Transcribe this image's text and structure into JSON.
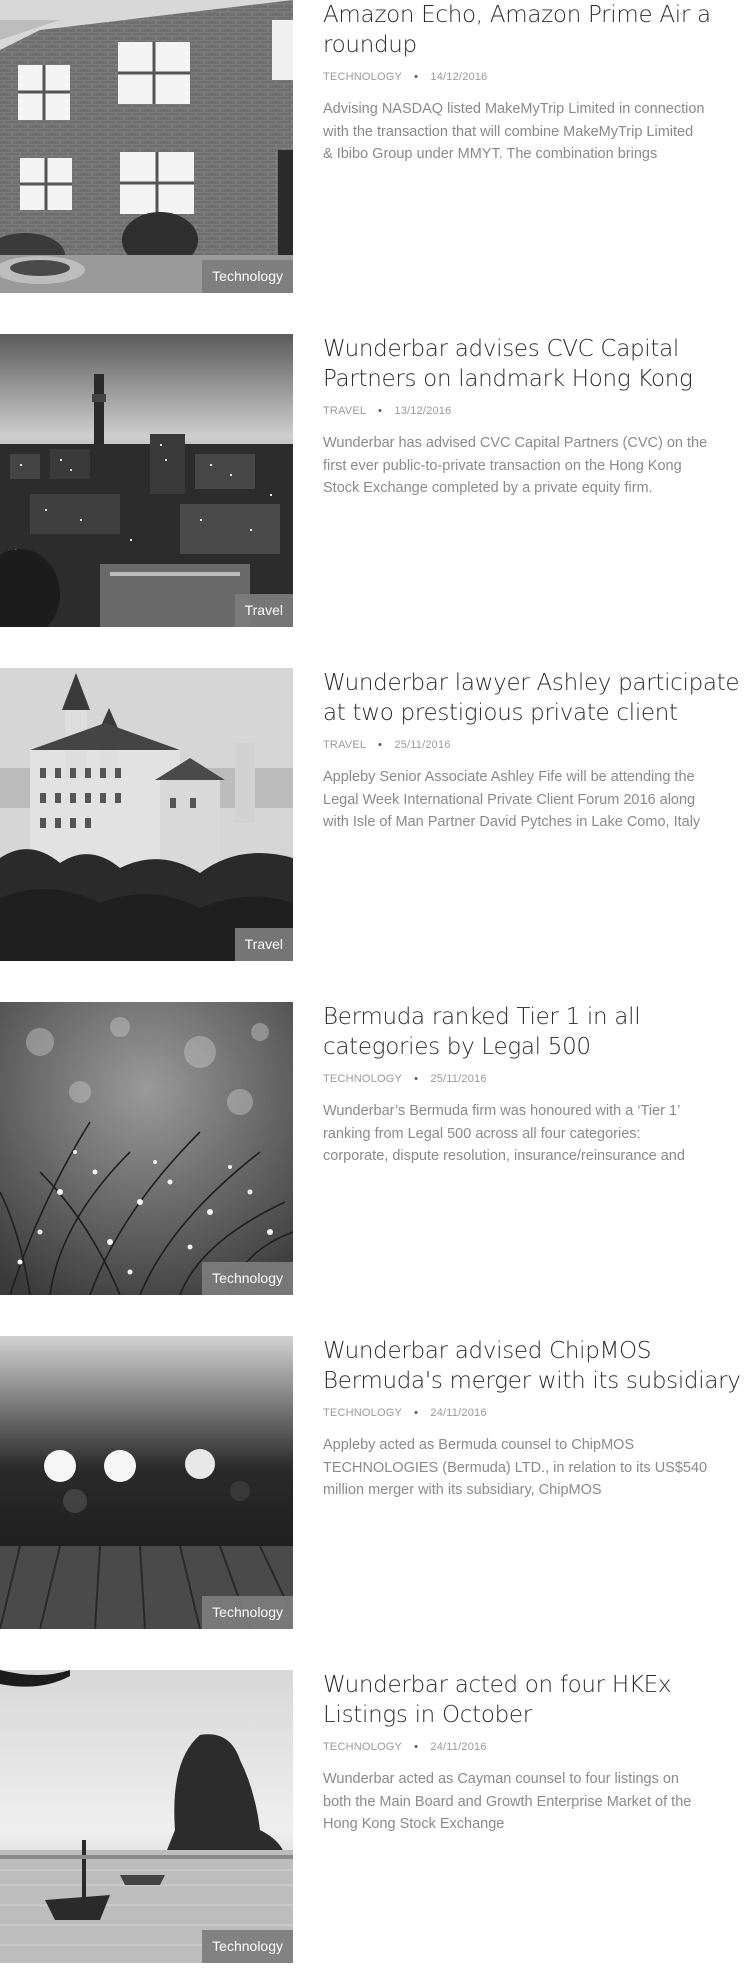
{
  "posts": [
    {
      "title_lines": [
        "Amazon Echo, Amazon Prime Air a",
        "roundup"
      ],
      "category": "TECHNOLOGY",
      "date": "14/12/2016",
      "excerpt_lines": [
        "Advising NASDAQ listed MakeMyTrip Limited in connection",
        "with the transaction that will combine MakeMyTrip Limited",
        "& Ibibo Group under MMYT. The combination brings"
      ],
      "badge": "Technology",
      "image": "brick-building-photo"
    },
    {
      "title_lines": [
        "Wunderbar advises CVC Capital",
        "Partners on landmark Hong Kong"
      ],
      "category": "TRAVEL",
      "date": "13/12/2016",
      "excerpt_lines": [
        "Wunderbar has advised CVC Capital Partners (CVC) on the",
        "first ever public-to-private transaction on the Hong Kong",
        "Stock Exchange completed by a private equity firm."
      ],
      "badge": "Travel",
      "image": "city-skyline-photo"
    },
    {
      "title_lines": [
        "Wunderbar lawyer Ashley participate",
        "at two prestigious private client"
      ],
      "category": "TRAVEL",
      "date": "25/11/2016",
      "excerpt_lines": [
        "Appleby Senior Associate Ashley Fife will be attending the",
        "Legal Week International Private Client Forum 2016 along",
        "with Isle of Man Partner David Pytches in Lake Como, Italy"
      ],
      "badge": "Travel",
      "image": "castle-photo"
    },
    {
      "title_lines": [
        "Bermuda ranked Tier 1 in all",
        "categories by Legal 500"
      ],
      "category": "TECHNOLOGY",
      "date": "25/11/2016",
      "excerpt_lines": [
        "Wunderbar’s Bermuda firm was honoured with a ‘Tier 1’",
        "ranking from Legal 500 across all four categories:",
        "corporate, dispute resolution, insurance/reinsurance and"
      ],
      "badge": "Technology",
      "image": "dewy-grass-photo"
    },
    {
      "title_lines": [
        "Wunderbar advised ChipMOS",
        "Bermuda's merger with its subsidiary"
      ],
      "category": "TECHNOLOGY",
      "date": "24/11/2016",
      "excerpt_lines": [
        "Appleby acted as Bermuda counsel to ChipMOS",
        "TECHNOLOGIES (Bermuda) LTD., in relation to its US$540",
        "million merger with its subsidiary, ChipMOS"
      ],
      "badge": "Technology",
      "image": "bokeh-deck-photo"
    },
    {
      "title_lines": [
        "Wunderbar acted on four HKEx",
        "Listings in October"
      ],
      "category": "TECHNOLOGY",
      "date": "24/11/2016",
      "excerpt_lines": [
        "Wunderbar acted as Cayman counsel to four listings on",
        "both the Main Board and Growth Enterprise Market of the",
        "Hong Kong Stock Exchange"
      ],
      "badge": "Technology",
      "image": "beach-boats-photo"
    }
  ]
}
